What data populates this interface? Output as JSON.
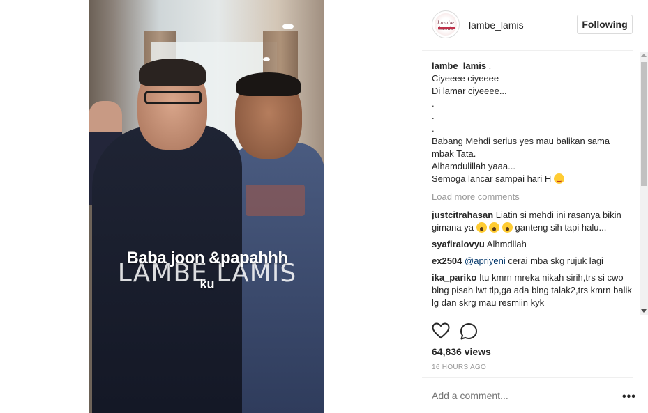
{
  "video": {
    "overlay_text": "Baba joon &papahhh",
    "overlay_brand": "LAMBE LAMIS",
    "overlay_sub": "ku"
  },
  "header": {
    "avatar_text": "Lambe Lamis",
    "username": "lambe_lamis",
    "follow_label": "Following"
  },
  "caption": {
    "username": "lambe_lamis",
    "lines": [
      ".",
      "Ciyeeee ciyeeee",
      "Di lamar ciyeeee...",
      ".",
      ".",
      ".",
      "Babang Mehdi serius yes mau balikan sama mbak Tata.",
      "Alhamdulillah yaaa...",
      "Semoga lancar sampai hari H"
    ]
  },
  "load_more": "Load more comments",
  "comments": [
    {
      "user": "justcitrahasan",
      "text_a": "Liatin si mehdi ini rasanya bikin gimana ya",
      "text_b": "ganteng sih tapi halu..."
    },
    {
      "user": "syafiralovyu",
      "text": "Alhmdllah"
    },
    {
      "user": "ex2504",
      "mention": "@apriyeni",
      "text": "cerai mba skg rujuk lagi"
    },
    {
      "user": "ika_pariko",
      "text": "Itu kmrn mreka nikah sirih,trs si cwo blng pisah lwt tlp,ga ada blng talak2,trs kmrn balik lg dan skrg mau resmiin kyk"
    }
  ],
  "actions": {
    "like_icon": "heart-icon",
    "comment_icon": "comment-bubble-icon",
    "views": "64,836 views",
    "time_ago": "16 HOURS AGO"
  },
  "add_comment": {
    "placeholder": "Add a comment...",
    "more_label": "•••"
  }
}
